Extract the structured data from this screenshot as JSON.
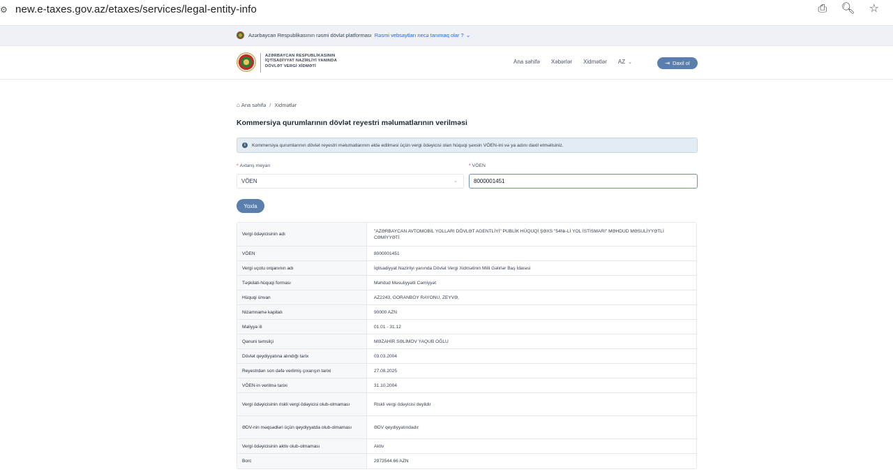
{
  "browser": {
    "url": "new.e-taxes.gov.az/etaxes/services/legal-entity-info",
    "icons": [
      "site-settings-icon",
      "install-app-icon",
      "zoom-icon",
      "bookmark-star-icon"
    ]
  },
  "gov_banner": {
    "text": "Azərbaycan Respublikasının rəsmi dövlət platforması",
    "link": "Rəsmi vebsaytları necə tanımaq olar ?"
  },
  "header": {
    "org_name": [
      "AZƏRBAYCAN RESPUBLİKASININ",
      "İQTİSADİYYAT NAZİRLİYİ YANINDA",
      "DÖVLƏT VERGİ XİDMƏTİ"
    ],
    "nav": [
      "Ana səhifə",
      "Xəbərlər",
      "Xidmətlər"
    ],
    "language": "AZ",
    "login": "Daxil ol"
  },
  "breadcrumb": {
    "home": "Ana səhifə",
    "separator": "/",
    "current": "Xidmətlər"
  },
  "page_title": "Kommersiya qurumlarının dövlət reyestri məlumatlarının verilməsi",
  "alert": "Kommersiya qurumlarının dövlət reyestri məlumatlarının əldə edilməsi üçün vergi ödəyicisi olan hüquqi şəxsin VÖEN-ini və ya adını daxil etməlisiniz.",
  "form": {
    "criteria_label": "Axtarış meyarı",
    "criteria_value": "VÖEN",
    "voen_label": "VÖEN",
    "voen_value": "8000001451",
    "submit": "Yoxla"
  },
  "result": [
    {
      "key": "Vergi ödəyicisinin adı",
      "value": "\"AZƏRBAYCAN AVTOMOBİL YOLLARI DÖVLƏT AGENTLİYİ\" PUBLİK HÜQUQİ ŞƏXS \"54№-Lİ YOL İSTİSMARI\" MƏHDUD MƏSULİYYƏTLİ CƏMİYYƏTİ"
    },
    {
      "key": "VÖEN",
      "value": "8000001451"
    },
    {
      "key": "Vergi uçotu orqanının adı",
      "value": "İqtisadiyyat Nazirliyi yanında Dövlət Vergi Xidmətinin Milli Gəlirlər Baş İdarəsi"
    },
    {
      "key": "Təşkilati-hüquqi forması",
      "value": "Məhdud Məsuliyyətli Cəmiyyət"
    },
    {
      "key": "Hüquqi ünvan",
      "value": "AZ2243, GORANBOY RAYONU, ZEYVƏ,"
    },
    {
      "key": "Nizamnamə kapitalı",
      "value": "90000 AZN"
    },
    {
      "key": "Maliyyə ili",
      "value": "01.01 - 31.12"
    },
    {
      "key": "Qanuni təmsilçi",
      "value": "MƏZAHİR SƏLİMOV YAQUB OĞLU"
    },
    {
      "key": "Dövlət qeydiyyatına alındığı tarix",
      "value": "03.03.2004"
    },
    {
      "key": "Reyestrdən son dəfə verilmiş çıxarışın tarixi",
      "value": "27.08.2025"
    },
    {
      "key": "VÖEN-in verilmə tarixi",
      "value": "31.10.2004"
    },
    {
      "key": "Vergi ödəyicisinin riskli vergi ödəyicisi olub-olmaması",
      "value": "Riskli vergi ödəyicisi deyildir"
    },
    {
      "key": "ƏDV-nin məqsədləri üçün qeydiyyatda olub-olmaması",
      "value": "ƏDV qeydiyyatındadır"
    },
    {
      "key": "Vergi ödəyicisinin aktiv olub-olmaması",
      "value": "Aktiv"
    },
    {
      "key": "Borc",
      "value": "2973544.66 AZN"
    }
  ]
}
